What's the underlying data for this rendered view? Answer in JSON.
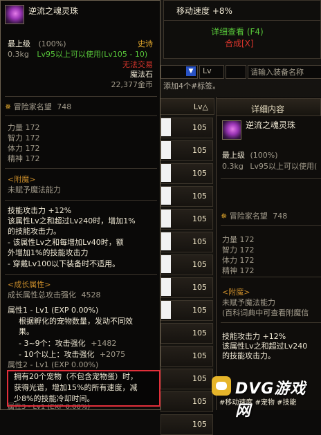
{
  "item": {
    "name": "逆流之魂灵珠",
    "grade": "最上级",
    "grade_pct": "(100%)",
    "rarity": "史诗",
    "weight": "0.3kg",
    "level_req": "Lv95以上可以使用(Lv105 - 10)",
    "trade": "无法交易",
    "type": "魔法石",
    "price": "22,377金币",
    "adventurer_rep": "冒险家名望",
    "adventurer_rep_val": "748",
    "stats": [
      {
        "name": "力量",
        "val": "172"
      },
      {
        "name": "智力",
        "val": "172"
      },
      {
        "name": "体力",
        "val": "172"
      },
      {
        "name": "精神",
        "val": "172"
      }
    ],
    "enchant_title": "<附魔>",
    "enchant_text": "未赋予魔法能力",
    "skill_lines": [
      "技能攻击力 +12%",
      "该属性Lv之和超过Lv240时，增加1%",
      "的技能攻击力。",
      "- 该属性Lv之和每增加Lv40时，额",
      "外增加1%的技能攻击力",
      "- 穿戴Lv100以下装备时不适用。"
    ],
    "growth_title": "<成长属性>",
    "growth_total_label": "成长属性总攻击强化",
    "growth_total_val": "4528",
    "attr1_title": "属性1 - Lv1 (EXP 0.00%)",
    "attr1_lines": [
      "根据孵化的宠物数量，发动不同效",
      "果。"
    ],
    "attr1_effect1_label": "- 3~9个：攻击强化",
    "attr1_effect1_val": "+1482",
    "attr1_effect2_label": "- 10个以上：攻击强化",
    "attr1_effect2_val": "+2075",
    "attr2_title": "属性2 - Lv1 (EXP 0.00%)",
    "attr2_lines": [
      "拥有20个宠物（不包含宠物蛋）时，",
      "获得光谱，增加15%的所有速度，减",
      "少8%的技能冷却时间。"
    ],
    "attr3_title": "属性3 - Lv1 (EXP 0.00%)"
  },
  "menu": {
    "move_speed": "移动速度 +8%",
    "detail_view": "详细查看 (F4)",
    "synthesize": "合成[X]"
  },
  "search": {
    "lv_label": "Lv",
    "placeholder": "请输入装备名称",
    "tag_hint": "添加4个#标签。"
  },
  "list": {
    "lv_header": "Lv△",
    "levels": [
      "105",
      "105",
      "105",
      "105",
      "105",
      "105",
      "105",
      "105",
      "105",
      "105",
      "105",
      "105",
      "105",
      "105"
    ]
  },
  "detail": {
    "header": "详细内容",
    "name": "逆流之魂灵珠",
    "grade": "最上级",
    "grade_pct": "(100%)",
    "weight": "0.3kg",
    "level_req": "Lv95以上可以使用(",
    "adventurer_rep": "冒险家名望",
    "adventurer_rep_val": "748",
    "stats": [
      {
        "name": "力量",
        "val": "172"
      },
      {
        "name": "智力",
        "val": "172"
      },
      {
        "name": "体力",
        "val": "172"
      },
      {
        "name": "精神",
        "val": "172"
      }
    ],
    "enchant_title": "<附魔>",
    "enchant_text": "未赋予魔法能力",
    "enchant_hint": "(百科词典中可查看附魔信",
    "skill_lines": [
      "技能攻击力 +12%",
      "该属性Lv之和超过Lv240",
      "的技能攻击力。"
    ],
    "bottom_partial": "#移动速度 #宠物 #技能"
  },
  "watermark": "DVG游戏网",
  "colors": {
    "highlight_border": "#e22f3a",
    "rarity_gold": "#e3a82c",
    "green": "#58c83a",
    "red": "#d8352c"
  }
}
